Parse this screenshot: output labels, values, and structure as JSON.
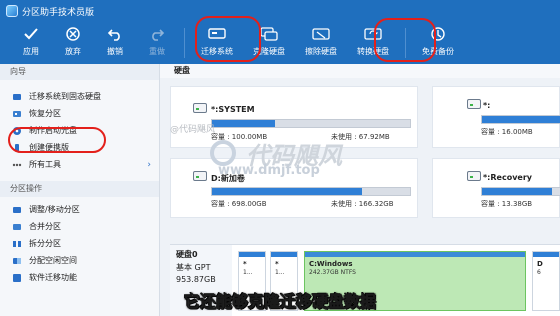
{
  "app": {
    "title": "分区助手技术员版"
  },
  "toolbar": {
    "items": [
      {
        "label": "应用",
        "icon": "check-icon",
        "disabled": false
      },
      {
        "label": "放弃",
        "icon": "cancel-icon",
        "disabled": false
      },
      {
        "label": "撤销",
        "icon": "undo-icon",
        "disabled": false
      },
      {
        "label": "重做",
        "icon": "redo-icon",
        "disabled": true
      },
      {
        "label": "迁移系统",
        "icon": "migrate-icon",
        "disabled": false
      },
      {
        "label": "克隆硬盘",
        "icon": "clone-disk-icon",
        "disabled": false
      },
      {
        "label": "擦除硬盘",
        "icon": "wipe-disk-icon",
        "disabled": false
      },
      {
        "label": "转换硬盘",
        "icon": "convert-disk-icon",
        "disabled": false
      },
      {
        "label": "免费备份",
        "icon": "backup-icon",
        "disabled": false
      }
    ]
  },
  "sidebar": {
    "wizard_header": "向导",
    "wizard_items": [
      {
        "label": "迁移系统到固态硬盘",
        "icon": "migrate-ssd-icon"
      },
      {
        "label": "恢复分区",
        "icon": "recover-partition-icon"
      },
      {
        "label": "制作启动光盘",
        "icon": "boot-disc-icon"
      },
      {
        "label": "创建便携版",
        "icon": "portable-icon"
      },
      {
        "label": "所有工具",
        "icon": "all-tools-icon",
        "has_arrow": true,
        "arrow": "›"
      }
    ],
    "partition_header": "分区操作",
    "partition_items": [
      {
        "label": "调整/移动分区",
        "icon": "resize-icon"
      },
      {
        "label": "合并分区",
        "icon": "merge-icon"
      },
      {
        "label": "拆分分区",
        "icon": "split-icon"
      },
      {
        "label": "分配空闲空间",
        "icon": "allocate-icon"
      },
      {
        "label": "软件迁移功能",
        "icon": "app-migrate-icon"
      }
    ]
  },
  "main": {
    "header": "硬盘",
    "drives": [
      {
        "name": "*:SYSTEM",
        "capacity": "容量 : 100.00MB",
        "free": "未使用 : 67.92MB",
        "used_fraction": 0.32
      },
      {
        "name": "*:",
        "capacity": "容量 : 16.00MB",
        "free": "",
        "used_fraction": 1.0
      },
      {
        "name": "D:新加卷",
        "capacity": "容量 : 698.00GB",
        "free": "未使用 : 166.32GB",
        "used_fraction": 0.76
      },
      {
        "name": "*:Recovery",
        "capacity": "容量 : 13.38GB",
        "free": "",
        "used_fraction": 0.9
      }
    ],
    "disk": {
      "name": "硬盘0",
      "type": "基本 GPT",
      "size": "953.87GB",
      "partitions": [
        {
          "label": "*",
          "sub": "1..."
        },
        {
          "label": "*",
          "sub": "1..."
        },
        {
          "label": "C:Windows",
          "sub": "242.37GB NTFS",
          "style": "green"
        },
        {
          "label": "D",
          "sub": "6"
        }
      ]
    }
  },
  "overlay": {
    "watermark_text": "@代码飓风",
    "logo_text": "代码飓风",
    "url_text": "www.dmjf.top",
    "subtitle": "它还能够克隆迁移硬盘数据"
  },
  "colors": {
    "toolbar_bg": "#1f6fbe",
    "accent": "#2f7fd6",
    "highlight_ring": "#e3201b"
  }
}
